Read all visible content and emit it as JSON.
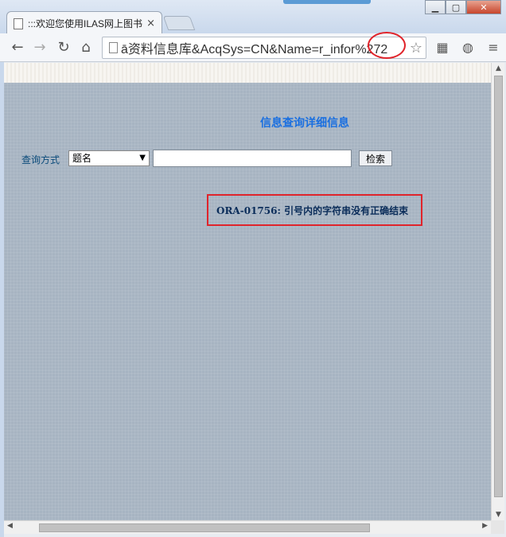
{
  "browser": {
    "tab_title": ":::欢迎您使用ILAS网上图书",
    "tab_close": "×",
    "url": "ā资料信息库&AcqSys=CN&Name=r_infor%272",
    "back_icon": "arrow-left-icon",
    "forward_icon": "arrow-right-icon",
    "reload_icon": "reload-icon",
    "home_icon": "home-icon",
    "star_icon": "star-icon",
    "window_controls": {
      "minimize": "▁",
      "maximize": "▢",
      "close": "✕"
    },
    "accent_color": "#5b9bd5"
  },
  "page": {
    "title": "信息查询详细信息",
    "query_label": "查询方式",
    "search_type": {
      "selected": "题名"
    },
    "search_input_value": "",
    "search_button_label": "检索",
    "error_message": "ORA-01756: 引号内的字符串没有正确结束",
    "highlight_color": "#e0242b",
    "title_color": "#1a6fe0"
  }
}
